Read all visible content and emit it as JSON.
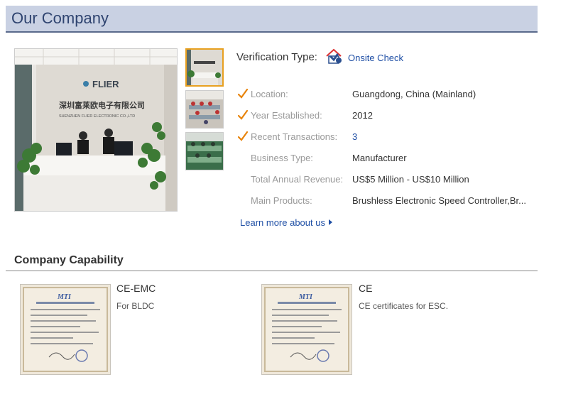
{
  "header": {
    "title": "Our Company"
  },
  "photo": {
    "logo_text": "FLIER",
    "company_cn": "深圳富莱欧电子有限公司",
    "company_en": "SHENZHEN FLIER ELECTRONIC CO.,LTD"
  },
  "verification": {
    "label": "Verification Type:",
    "value": "Onsite Check",
    "icon": "onsite-check-icon"
  },
  "details": [
    {
      "label": "Location:",
      "value": "Guangdong, China (Mainland)",
      "checked": true,
      "link": false
    },
    {
      "label": "Year Established:",
      "value": "2012",
      "checked": true,
      "link": false
    },
    {
      "label": "Recent Transactions:",
      "value": "3",
      "checked": true,
      "link": true
    },
    {
      "label": "Business Type:",
      "value": "Manufacturer",
      "checked": false,
      "link": false
    },
    {
      "label": "Total Annual Revenue:",
      "value": "US$5 Million - US$10 Million",
      "checked": false,
      "link": false
    },
    {
      "label": "Main Products:",
      "value": "Brushless Electronic Speed Controller,Br...",
      "checked": false,
      "link": false
    }
  ],
  "learn_more": "Learn more about us",
  "capability": {
    "title": "Company Capability",
    "certificates": [
      {
        "title": "CE-EMC",
        "desc": "For BLDC",
        "logo": "MTI"
      },
      {
        "title": "CE",
        "desc": "CE certificates for ESC.",
        "logo": "MTI"
      }
    ]
  },
  "colors": {
    "header_bg": "#c9d1e3",
    "header_text": "#2f4470",
    "link": "#1f4fa5",
    "check": "#e8840c"
  }
}
